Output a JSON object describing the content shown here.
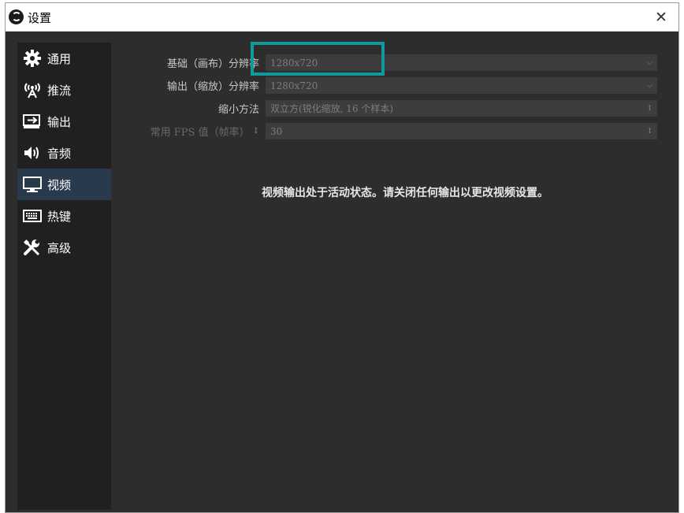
{
  "window": {
    "title": "设置",
    "close_glyph": "✕"
  },
  "sidebar": {
    "items": [
      {
        "label": "通用",
        "icon": "gear-icon",
        "active": false
      },
      {
        "label": "推流",
        "icon": "broadcast-icon",
        "active": false
      },
      {
        "label": "输出",
        "icon": "output-icon",
        "active": false
      },
      {
        "label": "音频",
        "icon": "speaker-icon",
        "active": false
      },
      {
        "label": "视频",
        "icon": "monitor-icon",
        "active": true
      },
      {
        "label": "热键",
        "icon": "keyboard-icon",
        "active": false
      },
      {
        "label": "高级",
        "icon": "tools-icon",
        "active": false
      }
    ]
  },
  "video": {
    "base_resolution": {
      "label": "基础（画布）分辨率",
      "value": "1280x720"
    },
    "output_resolution": {
      "label": "输出（缩放）分辨率",
      "value": "1280x720"
    },
    "downscale_filter": {
      "label": "缩小方法",
      "value": "双立方(锐化缩放, 16 个样本)"
    },
    "fps": {
      "label": "常用 FPS 值（帧率）",
      "value": "30"
    },
    "notice": "视频输出处于活动状态。请关闭任何输出以更改视频设置。"
  },
  "colors": {
    "background": "#2d2d2d",
    "sidebar": "#202020",
    "active_item": "#2a3a4d",
    "highlight": "#0f9b9b"
  }
}
